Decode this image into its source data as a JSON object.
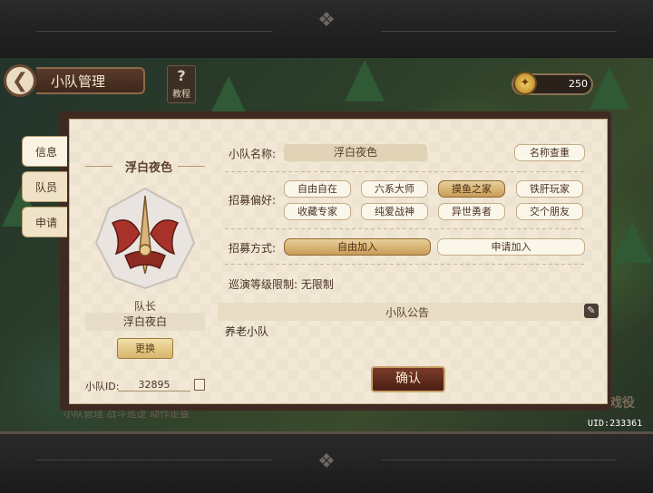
{
  "header": {
    "back": "❮",
    "title": "小队管理",
    "tutorial_label": "教程",
    "tutorial_glyph": "?"
  },
  "currency": {
    "icon": "coin-icon",
    "value": "250"
  },
  "side_tabs": [
    {
      "label": "信息",
      "active": true
    },
    {
      "label": "队员",
      "active": false
    },
    {
      "label": "申请",
      "active": false
    }
  ],
  "team": {
    "name": "浮白夜色",
    "leader_label": "队长",
    "leader_name": "浮白夜白",
    "replace_label": "更换",
    "id_label": "小队ID:",
    "id_value": "32895"
  },
  "form": {
    "name_label": "小队名称:",
    "name_value": "浮白夜色",
    "name_check_label": "名称查重",
    "pref_label": "招募偏好:",
    "prefs": [
      {
        "label": "自由自在",
        "selected": false
      },
      {
        "label": "六系大师",
        "selected": false
      },
      {
        "label": "摸鱼之家",
        "selected": true
      },
      {
        "label": "铁肝玩家",
        "selected": false
      },
      {
        "label": "收藏专家",
        "selected": false
      },
      {
        "label": "纯爱战神",
        "selected": false
      },
      {
        "label": "异世勇者",
        "selected": false
      },
      {
        "label": "交个朋友",
        "selected": false
      }
    ],
    "method_label": "招募方式:",
    "methods": [
      {
        "label": "自由加入",
        "selected": true
      },
      {
        "label": "申请加入",
        "selected": false
      }
    ],
    "level_limit": "巡演等级限制: 无限制",
    "notice_title": "小队公告",
    "notice_text": "养老小队"
  },
  "confirm_label": "确认",
  "uid_corner": "UID:233361",
  "background_texts": {
    "bottom_left": "小队管理  战斗巡逻  动作走查",
    "bottom_right": "戏役"
  },
  "colors": {
    "panel": "#f2e8d5",
    "selected": "#c99c57",
    "confirm": "#5a2a1c"
  }
}
